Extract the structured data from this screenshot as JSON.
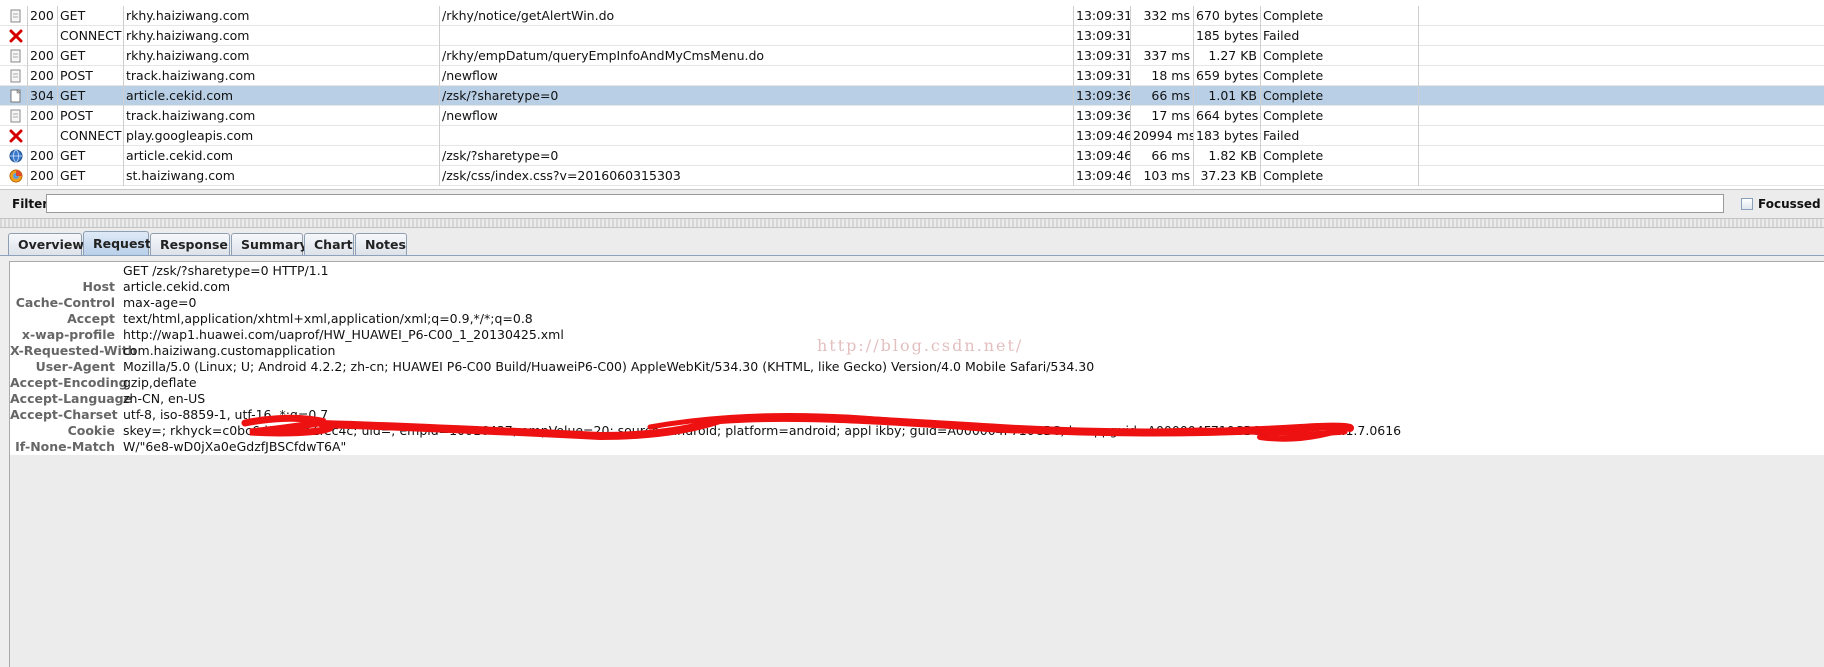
{
  "colors": {
    "selected_row": "#b8cfe5",
    "tab_active": "#b9d0ea",
    "failed_icon": "#d40000",
    "scribble": "#ee1111",
    "key_text": "#666666",
    "watermark": "#e3bfbf"
  },
  "sessions": [
    {
      "icon": "document-icon",
      "status": "200",
      "method": "GET",
      "host": "rkhy.haiziwang.com",
      "path": "/rkhy/notice/getAlertWin.do",
      "time": "13:09:31",
      "duration": "332 ms",
      "size": "670 bytes",
      "state": "Complete",
      "selected": false
    },
    {
      "icon": "failed-icon",
      "status": "",
      "method": "CONNECT",
      "host": "rkhy.haiziwang.com",
      "path": "",
      "time": "13:09:31",
      "duration": "",
      "size": "185 bytes",
      "state": "Failed",
      "selected": false
    },
    {
      "icon": "document-icon",
      "status": "200",
      "method": "GET",
      "host": "rkhy.haiziwang.com",
      "path": "/rkhy/empDatum/queryEmpInfoAndMyCmsMenu.do",
      "time": "13:09:31",
      "duration": "337 ms",
      "size": "1.27 KB",
      "state": "Complete",
      "selected": false
    },
    {
      "icon": "document-icon",
      "status": "200",
      "method": "POST",
      "host": "track.haiziwang.com",
      "path": "/newflow",
      "time": "13:09:31",
      "duration": "18 ms",
      "size": "659 bytes",
      "state": "Complete",
      "selected": false
    },
    {
      "icon": "not-modified-icon",
      "status": "304",
      "method": "GET",
      "host": "article.cekid.com",
      "path": "/zsk/?sharetype=0",
      "time": "13:09:36",
      "duration": "66 ms",
      "size": "1.01 KB",
      "state": "Complete",
      "selected": true
    },
    {
      "icon": "document-icon",
      "status": "200",
      "method": "POST",
      "host": "track.haiziwang.com",
      "path": "/newflow",
      "time": "13:09:36",
      "duration": "17 ms",
      "size": "664 bytes",
      "state": "Complete",
      "selected": false
    },
    {
      "icon": "failed-icon",
      "status": "",
      "method": "CONNECT",
      "host": "play.googleapis.com",
      "path": "",
      "time": "13:09:46",
      "duration": "20994 ms",
      "size": "183 bytes",
      "state": "Failed",
      "selected": false
    },
    {
      "icon": "html-icon",
      "status": "200",
      "method": "GET",
      "host": "article.cekid.com",
      "path": "/zsk/?sharetype=0",
      "time": "13:09:46",
      "duration": "66 ms",
      "size": "1.82 KB",
      "state": "Complete",
      "selected": false
    },
    {
      "icon": "css-icon",
      "status": "200",
      "method": "GET",
      "host": "st.haiziwang.com",
      "path": "/zsk/css/index.css?v=2016060315303",
      "time": "13:09:46",
      "duration": "103 ms",
      "size": "37.23 KB",
      "state": "Complete",
      "selected": false
    }
  ],
  "filter": {
    "label": "Filter:",
    "value": "",
    "focussed_label": "Focussed"
  },
  "tabs": [
    {
      "label": "Overview",
      "active": false
    },
    {
      "label": "Request",
      "active": true
    },
    {
      "label": "Response",
      "active": false
    },
    {
      "label": "Summary",
      "active": false
    },
    {
      "label": "Chart",
      "active": false
    },
    {
      "label": "Notes",
      "active": false
    }
  ],
  "request": {
    "request_line": "GET /zsk/?sharetype=0 HTTP/1.1",
    "headers": [
      {
        "key": "Host",
        "value": "article.cekid.com"
      },
      {
        "key": "Cache-Control",
        "value": "max-age=0"
      },
      {
        "key": "Accept",
        "value": "text/html,application/xhtml+xml,application/xml;q=0.9,*/*;q=0.8"
      },
      {
        "key": "x-wap-profile",
        "value": "http://wap1.huawei.com/uaprof/HW_HUAWEI_P6-C00_1_20130425.xml"
      },
      {
        "key": "X-Requested-With",
        "value": "com.haiziwang.customapplication"
      },
      {
        "key": "User-Agent",
        "value": "Mozilla/5.0 (Linux; U; Android 4.2.2; zh-cn; HUAWEI P6-C00 Build/HuaweiP6-C00) AppleWebKit/534.30 (KHTML, like Gecko) Version/4.0 Mobile Safari/534.30"
      },
      {
        "key": "Accept-Encoding",
        "value": "gzip,deflate"
      },
      {
        "key": "Accept-Language",
        "value": "zh-CN, en-US"
      },
      {
        "key": "Accept-Charset",
        "value": "utf-8, iso-8859-1, utf-16, *;q=0.7"
      },
      {
        "key": "Cookie",
        "value": "skey=; rkhyck=c0bc6d0b                  d1b1fec4c; uid=; empid=10016437; empVolue=20; source=android; platform=android; appl     ikby; guid=A000004F710CBC; kwappguid=A000004F710CBC; version=V1.1.7.0616"
      },
      {
        "key": "If-None-Match",
        "value": "W/\"6e8-wD0jXa0eGdzfJBSCfdwT6A\""
      }
    ]
  },
  "watermark": "http://blog.csdn.net/"
}
